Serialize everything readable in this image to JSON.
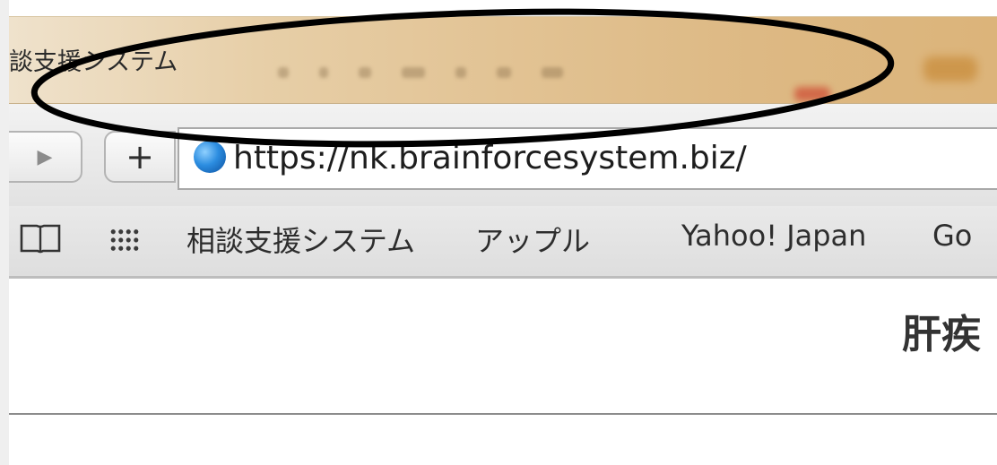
{
  "window": {
    "title": "談支援システム"
  },
  "toolbar": {
    "forward_icon": "▶",
    "add_icon": "+",
    "url": "https://nk.brainforcesystem.biz/"
  },
  "bookmarks": {
    "items": [
      "相談支援システム",
      "アップル",
      "Yahoo! Japan",
      "Go"
    ]
  },
  "page": {
    "title": "肝疾"
  },
  "colors": {
    "annotation_stroke": "#000000",
    "divider": "#8c8c8c"
  }
}
